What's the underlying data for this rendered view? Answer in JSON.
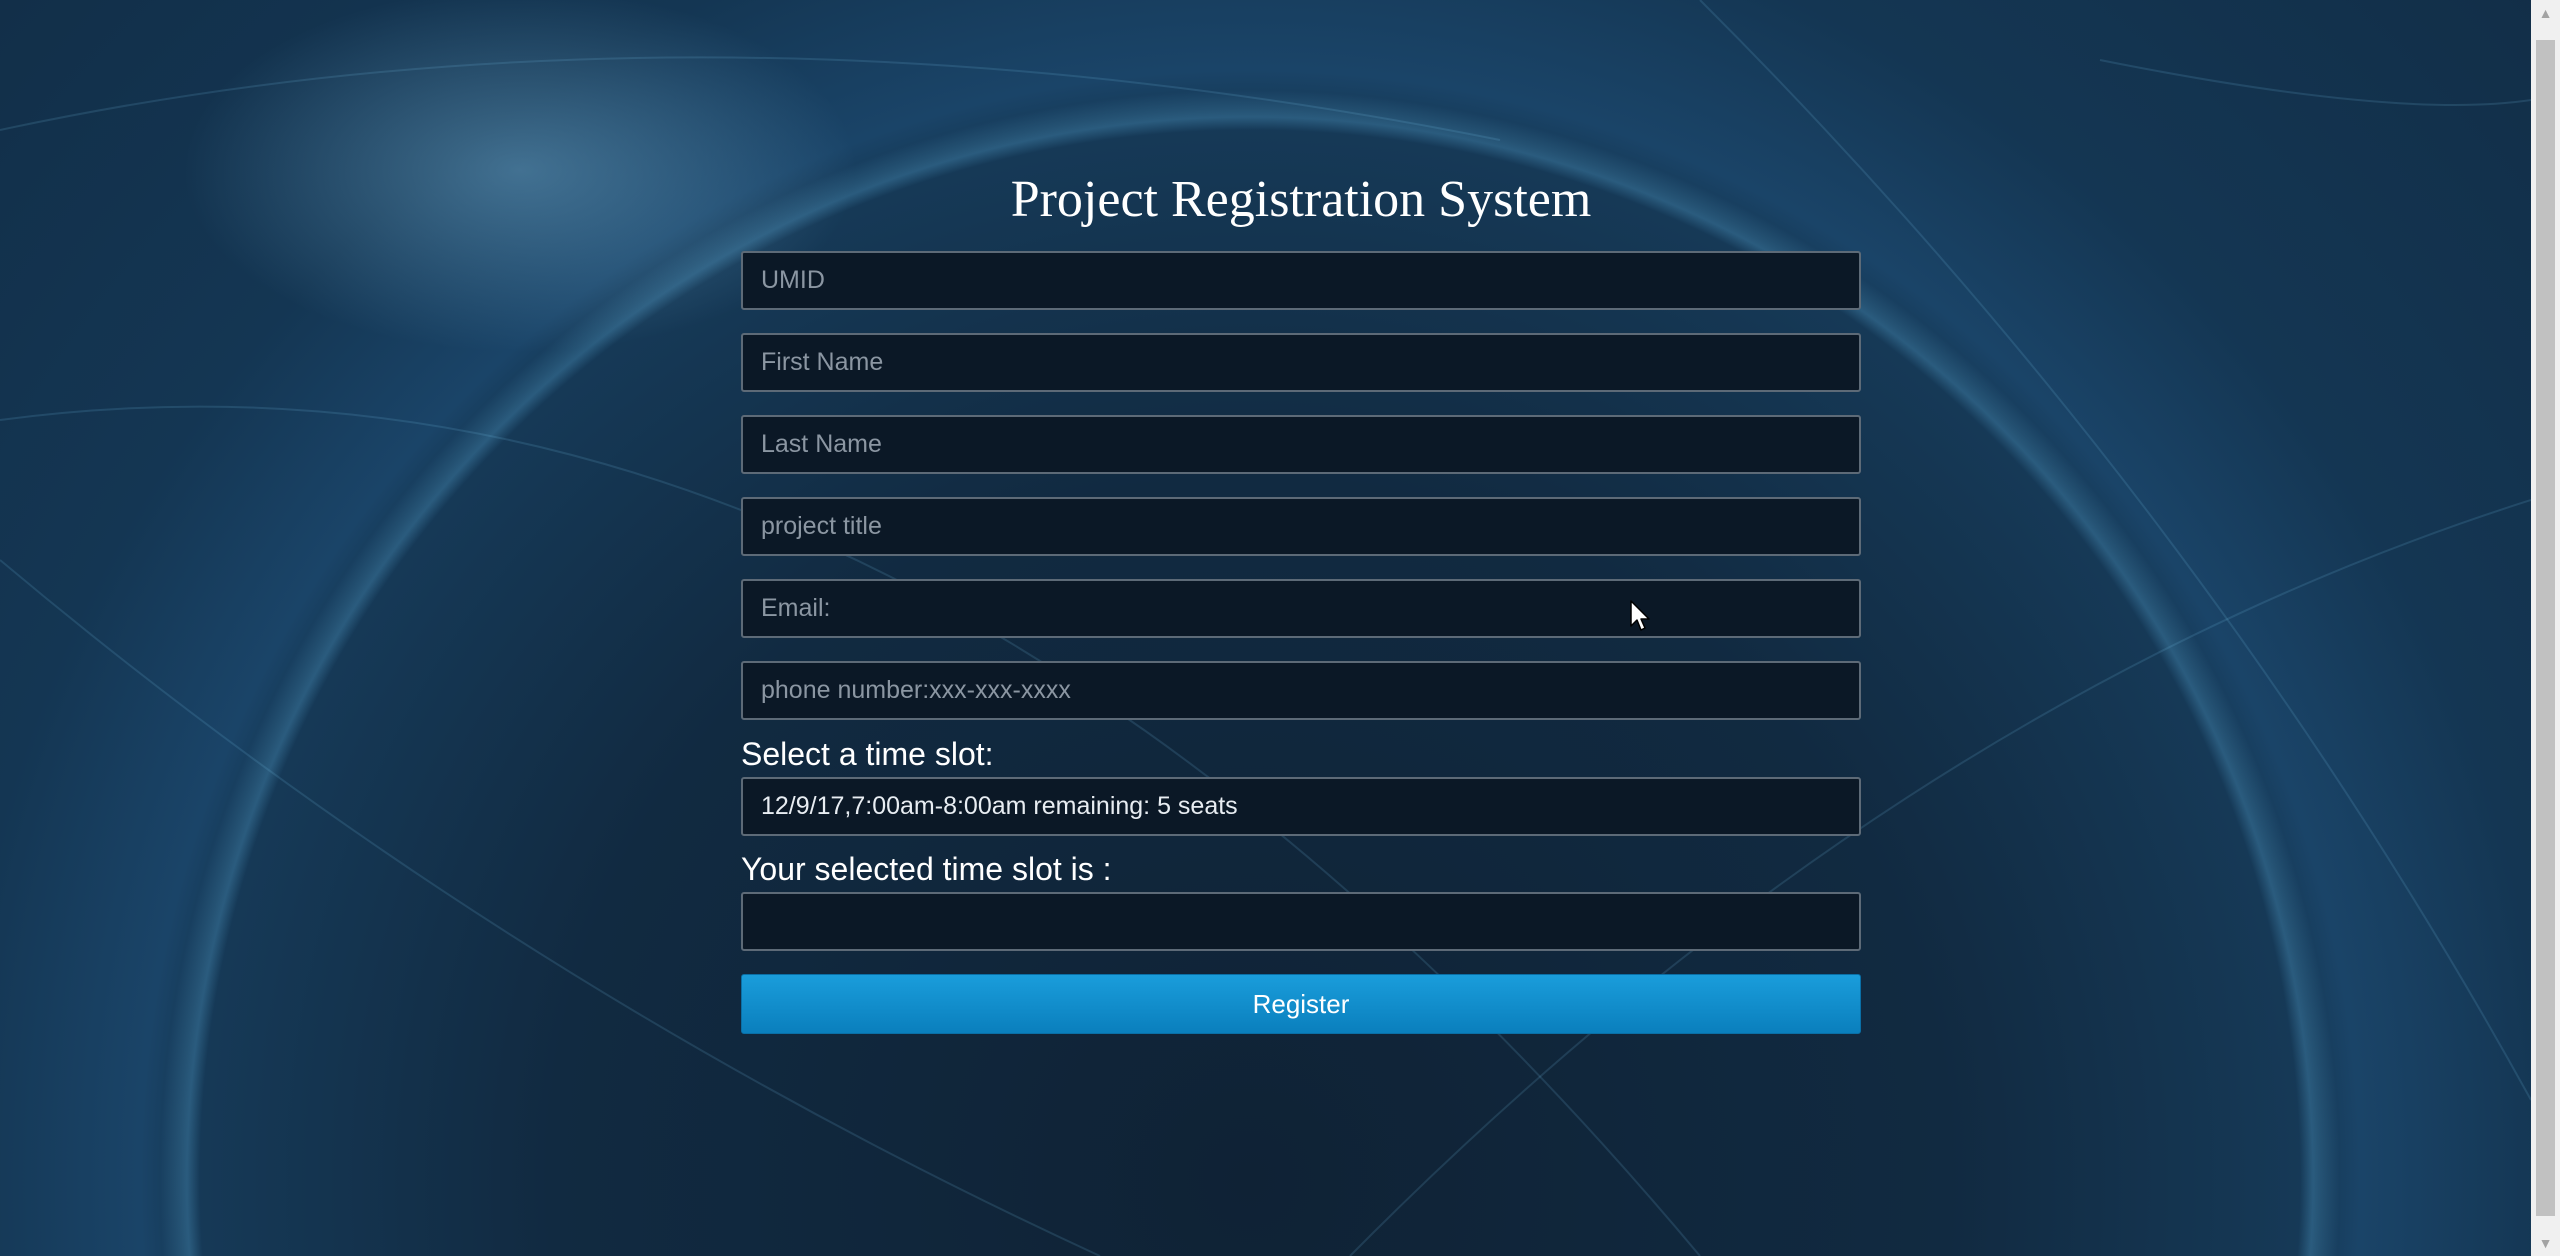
{
  "page": {
    "title": "Project Registration System"
  },
  "form": {
    "fields": [
      {
        "name": "umid-input",
        "placeholder": "UMID",
        "value": ""
      },
      {
        "name": "first-name-input",
        "placeholder": "First Name",
        "value": ""
      },
      {
        "name": "last-name-input",
        "placeholder": "Last Name",
        "value": ""
      },
      {
        "name": "project-title-input",
        "placeholder": "project title",
        "value": ""
      },
      {
        "name": "email-input",
        "placeholder": "Email:",
        "value": ""
      },
      {
        "name": "phone-input",
        "placeholder": "phone number:xxx-xxx-xxxx",
        "value": ""
      }
    ],
    "time_slot_label": "Select a time slot:",
    "time_slot_selected": "12/9/17,7:00am-8:00am remaining: 5 seats",
    "selected_slot_label": "Your selected time slot is :",
    "selected_slot_value": "",
    "register_label": "Register"
  },
  "colors": {
    "background": "#123049",
    "field_background": "#0b1826",
    "field_border": "#5d6a77",
    "button": "#1592d0",
    "text": "#ffffff"
  },
  "icons": {
    "scroll_up": "triangle-up-icon",
    "scroll_down": "triangle-down-icon",
    "cursor": "mouse-pointer-icon"
  }
}
